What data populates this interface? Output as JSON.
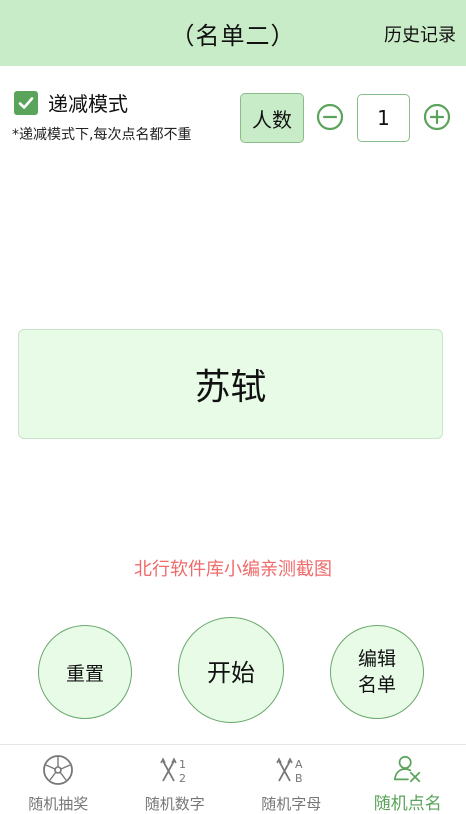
{
  "header": {
    "title": "（名单二）",
    "history_label": "历史记录"
  },
  "mode": {
    "checked": true,
    "label": "递减模式",
    "note": "*递减模式下,每次点名都不重"
  },
  "count": {
    "label": "人数",
    "value": "1"
  },
  "result": {
    "name": "苏轼"
  },
  "watermark": "北行软件库小编亲测截图",
  "actions": {
    "reset_label": "重置",
    "start_label": "开始",
    "edit_line1": "编辑",
    "edit_line2": "名单"
  },
  "tabs": [
    {
      "label": "随机抽奖",
      "icon": "wheel-icon",
      "active": false
    },
    {
      "label": "随机数字",
      "icon": "shuffle-numbers-icon",
      "active": false
    },
    {
      "label": "随机字母",
      "icon": "shuffle-letters-icon",
      "active": false
    },
    {
      "label": "随机点名",
      "icon": "person-select-icon",
      "active": true
    }
  ],
  "colors": {
    "header_bg": "#c9ecc8",
    "accent": "#5aa35a",
    "card_bg": "#e7fbe7",
    "watermark": "#f06a6a"
  }
}
